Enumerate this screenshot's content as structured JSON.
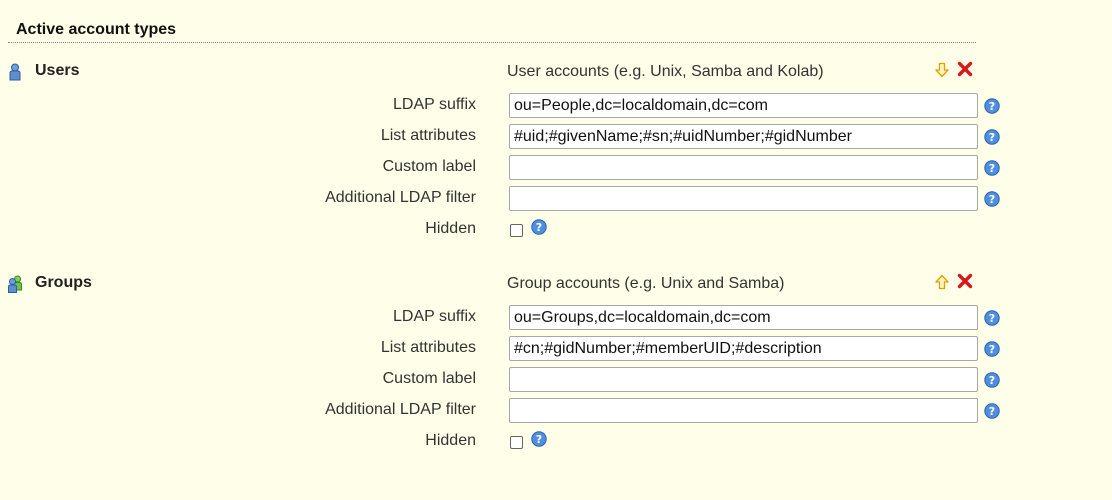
{
  "section": {
    "title": "Active account types"
  },
  "types": [
    {
      "name": "Users",
      "icon": "user-icon",
      "description": "User accounts (e.g. Unix, Samba and Kolab)",
      "move_icon": "arrow-down-icon",
      "fields": {
        "ldap_suffix": {
          "label": "LDAP suffix",
          "value": "ou=People,dc=localdomain,dc=com"
        },
        "list_attributes": {
          "label": "List attributes",
          "value": "#uid;#givenName;#sn;#uidNumber;#gidNumber"
        },
        "custom_label": {
          "label": "Custom label",
          "value": ""
        },
        "ldap_filter": {
          "label": "Additional LDAP filter",
          "value": ""
        },
        "hidden": {
          "label": "Hidden",
          "checked": false
        }
      }
    },
    {
      "name": "Groups",
      "icon": "group-icon",
      "description": "Group accounts (e.g. Unix and Samba)",
      "move_icon": "arrow-up-icon",
      "fields": {
        "ldap_suffix": {
          "label": "LDAP suffix",
          "value": "ou=Groups,dc=localdomain,dc=com"
        },
        "list_attributes": {
          "label": "List attributes",
          "value": "#cn;#gidNumber;#memberUID;#description"
        },
        "custom_label": {
          "label": "Custom label",
          "value": ""
        },
        "ldap_filter": {
          "label": "Additional LDAP filter",
          "value": ""
        },
        "hidden": {
          "label": "Hidden",
          "checked": false
        }
      }
    }
  ],
  "colors": {
    "background": "#fffee8",
    "delete": "#e01010",
    "move_arrow": "#f0b400",
    "help": "#3d7fd8",
    "user_icon": "#4f86c6",
    "group_icon": "#4caf3a"
  }
}
